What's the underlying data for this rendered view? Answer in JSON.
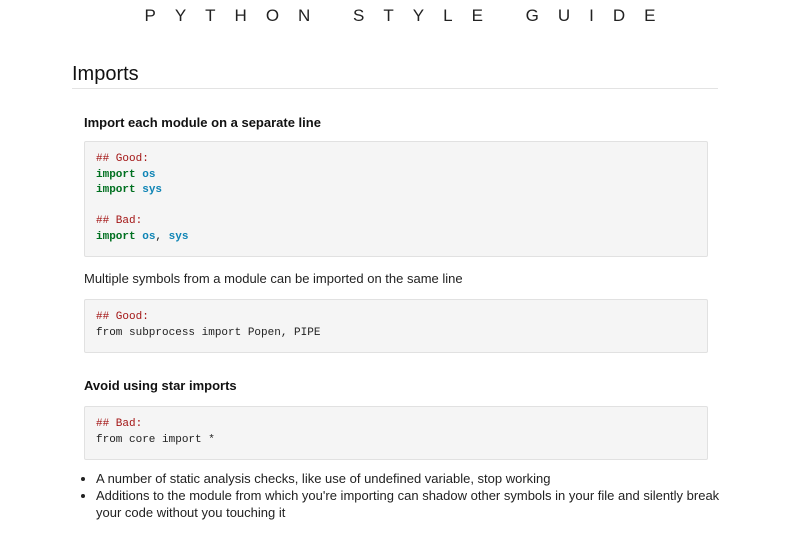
{
  "header": {
    "site_title": "PYTHON STYLE GUIDE"
  },
  "section": {
    "title": "Imports"
  },
  "blocks": {
    "separate_line": {
      "heading": "Import each module on a separate line",
      "code": {
        "good_comment": "## Good:",
        "good_kw_1": "import",
        "good_mod_1": "os",
        "good_kw_2": "import",
        "good_mod_2": "sys",
        "bad_comment": "## Bad:",
        "bad_kw": "import",
        "bad_mod_1": "os",
        "bad_sep": ", ",
        "bad_mod_2": "sys"
      }
    },
    "same_line": {
      "paragraph": "Multiple symbols from a module can be imported on the same line",
      "code": {
        "good_comment": "## Good:",
        "line": "from subprocess import Popen, PIPE"
      }
    },
    "star_imports": {
      "heading": "Avoid using star imports",
      "code": {
        "bad_comment": "## Bad:",
        "line": "from core import *"
      },
      "bullets": [
        "A number of static analysis checks, like use of undefined variable, stop working",
        "Additions to the module from which you're importing can shadow other symbols in your file and silently break your code without you touching it"
      ]
    }
  }
}
